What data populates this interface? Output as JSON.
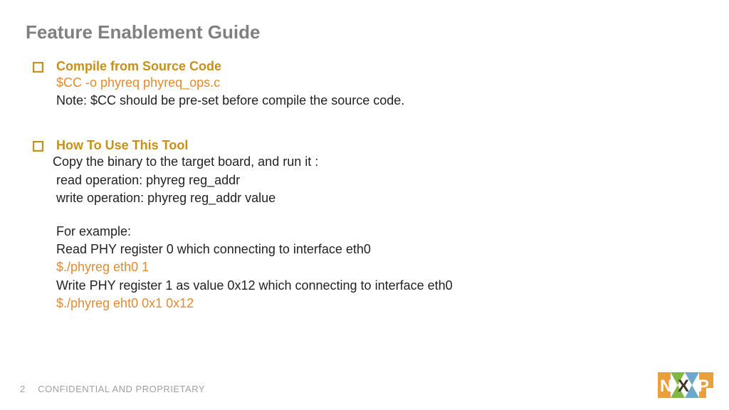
{
  "title": "Feature Enablement Guide",
  "section1": {
    "heading": "Compile from Source Code",
    "command": "$CC -o phyreq phyreq_ops.c",
    "note": "Note: $CC should be pre-set before compile the source code."
  },
  "section2": {
    "heading": "How To Use This Tool",
    "intro": "Copy the binary to the target board, and run it :",
    "read_op": "read operation: phyreg reg_addr",
    "write_op": "write operation: phyreg reg_addr value",
    "example_label": "For example:",
    "read_desc": "Read PHY register 0 which connecting to interface eth0",
    "read_cmd": "$./phyreg eth0 1",
    "write_desc": "Write PHY register 1 as value 0x12 which connecting to interface eth0",
    "write_cmd": "$./phyreg eht0 0x1 0x12"
  },
  "footer": {
    "page": "2",
    "confidential": "CONFIDENTIAL AND PROPRIETARY"
  }
}
